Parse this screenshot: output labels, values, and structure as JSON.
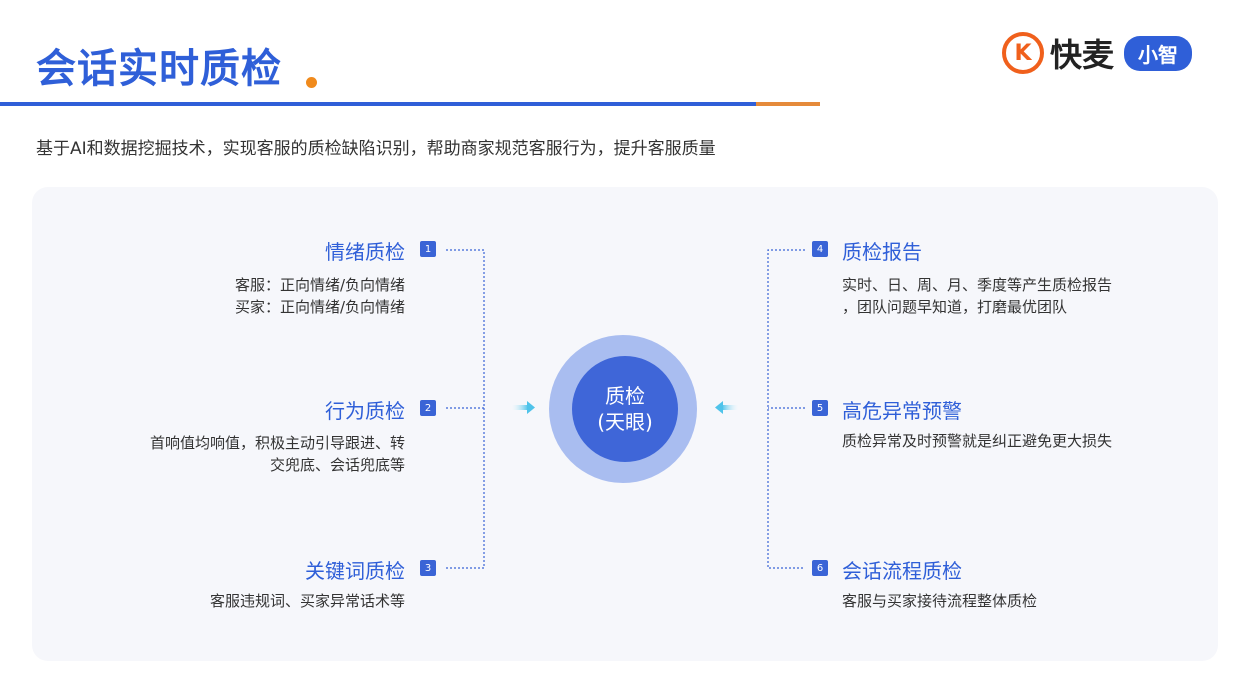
{
  "header": {
    "title": "会话实时质检",
    "subtitle": "基于AI和数据挖掘技术，实现客服的质检缺陷识别，帮助商家规范客服行为，提升客服质量"
  },
  "logo": {
    "symbol": "K",
    "brand": "快麦",
    "badge": "小智"
  },
  "center": {
    "line1": "质检",
    "line2": "(天眼)"
  },
  "left_items": [
    {
      "num": "1",
      "title": "情绪质检",
      "desc1": "客服：正向情绪/负向情绪",
      "desc2": "买家：正向情绪/负向情绪"
    },
    {
      "num": "2",
      "title": "行为质检",
      "desc1": "首响值均响值，积极主动引导跟进、转",
      "desc2": "交兜底、会话兜底等"
    },
    {
      "num": "3",
      "title": "关键词质检",
      "desc1": "客服违规词、买家异常话术等",
      "desc2": ""
    }
  ],
  "right_items": [
    {
      "num": "4",
      "title": "质检报告",
      "desc1": "实时、日、周、月、季度等产生质检报告",
      "desc2": "，团队问题早知道，打磨最优团队"
    },
    {
      "num": "5",
      "title": "高危异常预警",
      "desc1": "质检异常及时预警就是纠正避免更大损失",
      "desc2": ""
    },
    {
      "num": "6",
      "title": "会话流程质检",
      "desc1": "客服与买家接待流程整体质检",
      "desc2": ""
    }
  ],
  "colors": {
    "primary": "#2f5fd8",
    "accent": "#f08a1c",
    "circle_outer": "#a9bdf0",
    "circle_inner": "#3f66d8"
  }
}
